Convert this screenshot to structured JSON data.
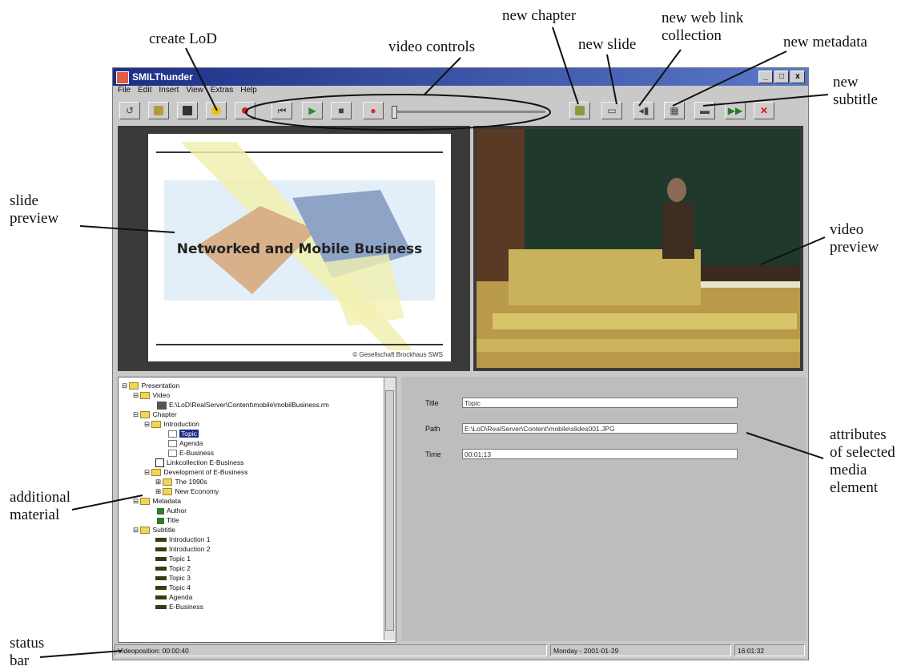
{
  "callouts": {
    "create_lod": "create LoD",
    "video_controls": "video controls",
    "new_chapter": "new chapter",
    "new_slide": "new slide",
    "new_web_link_collection": "new web link\ncollection",
    "new_metadata": "new metadata",
    "new_subtitle": "new\nsubtitle",
    "slide_preview": "slide\npreview",
    "video_preview": "video\npreview",
    "attributes": "attributes\nof selected\nmedia\nelement",
    "additional_material": "additional\nmaterial",
    "status_bar": "status\nbar"
  },
  "window": {
    "title": "SMILThunder",
    "minimize": "_",
    "maximize": "□",
    "close": "x",
    "menu": [
      "File",
      "Edit",
      "Insert",
      "View",
      "Extras",
      "Help"
    ]
  },
  "slide": {
    "title": "Networked and Mobile Business",
    "footer": "© Gesellschaft Brockhaus SWS"
  },
  "tree": {
    "root": "Presentation",
    "video_folder": "Video",
    "video_file": "E:\\LoD\\RealServer\\Content\\mobile\\mobilBusiness.rm",
    "chapter_folder": "Chapter",
    "introduction": "Introduction",
    "topic": "Topic",
    "agenda": "Agenda",
    "ebusiness": "E-Business",
    "link_collection": "Linkcollection E-Business",
    "development": "Development of E-Business",
    "the1990s": "The 1990s",
    "new_economy": "New Economy",
    "metadata": "Metadata",
    "author": "Author",
    "title_meta": "Title",
    "subtitle_folder": "Subtitle",
    "subtitles": [
      "Introduction 1",
      "Introduction 2",
      "Topic 1",
      "Topic 2",
      "Topic 3",
      "Topic 4",
      "Agenda",
      "E-Business"
    ]
  },
  "attributes": {
    "title_label": "Title",
    "title_value": "Topic",
    "path_label": "Path",
    "path_value": "E:\\LoD\\RealServer\\Content\\mobile\\slides001.JPG",
    "time_label": "Time",
    "time_value": "00:01:13"
  },
  "status": {
    "videoposition": "Videoposition: 00:00:40",
    "date": "Monday - 2001-01-29",
    "clock": "16:01:32"
  }
}
